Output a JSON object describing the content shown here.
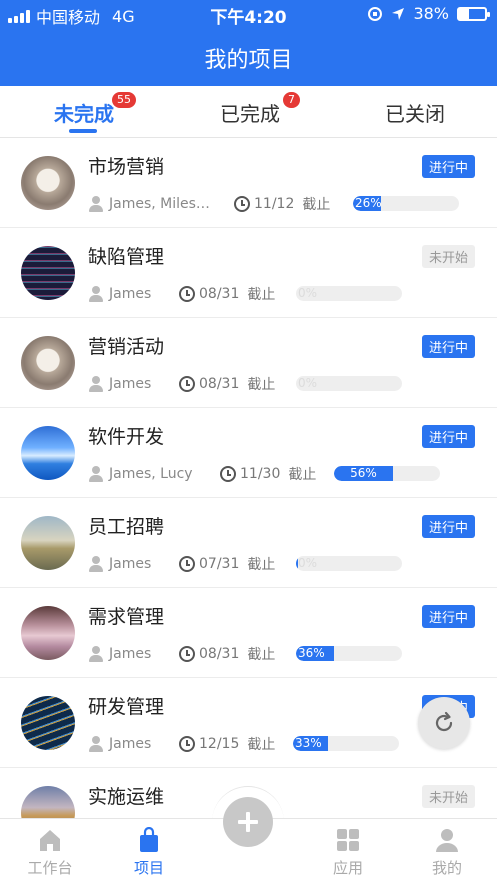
{
  "status_bar": {
    "carrier": "中国移动",
    "network": "4G",
    "time": "下午4:20",
    "battery": "38%",
    "battery_level": 0.38
  },
  "header": {
    "title": "我的项目"
  },
  "tabs": [
    {
      "label": "未完成",
      "badge": "55",
      "active": true
    },
    {
      "label": "已完成",
      "badge": "7",
      "active": false
    },
    {
      "label": "已关闭",
      "badge": "",
      "active": false
    }
  ],
  "projects": [
    {
      "name": "市场营销",
      "status": "进行中",
      "members": "James, Miles…",
      "date": "11/12",
      "deadline_label": "截止",
      "progress": 26,
      "progress_text": "26%"
    },
    {
      "name": "缺陷管理",
      "status": "未开始",
      "members": "James",
      "date": "08/31",
      "deadline_label": "截止",
      "progress": 0,
      "progress_text": "0%"
    },
    {
      "name": "营销活动",
      "status": "进行中",
      "members": "James",
      "date": "08/31",
      "deadline_label": "截止",
      "progress": 0,
      "progress_text": "0%"
    },
    {
      "name": "软件开发",
      "status": "进行中",
      "members": "James, Lucy",
      "date": "11/30",
      "deadline_label": "截止",
      "progress": 56,
      "progress_text": "56%"
    },
    {
      "name": "员工招聘",
      "status": "进行中",
      "members": "James",
      "date": "07/31",
      "deadline_label": "截止",
      "progress": 2,
      "progress_text": "0%"
    },
    {
      "name": "需求管理",
      "status": "进行中",
      "members": "James",
      "date": "08/31",
      "deadline_label": "截止",
      "progress": 36,
      "progress_text": "36%"
    },
    {
      "name": "研发管理",
      "status": "进行中",
      "members": "James",
      "date": "12/15",
      "deadline_label": "截止",
      "progress": 33,
      "progress_text": "33%"
    },
    {
      "name": "实施运维",
      "status": "未开始",
      "members": "",
      "date": "",
      "deadline_label": "",
      "progress": 0,
      "progress_text": ""
    }
  ],
  "tabbar": {
    "items": [
      {
        "label": "工作台",
        "icon": "home-icon",
        "active": false
      },
      {
        "label": "项目",
        "icon": "bag-icon",
        "active": true
      },
      {
        "label": "应用",
        "icon": "grid-icon",
        "active": false
      },
      {
        "label": "我的",
        "icon": "user-icon",
        "active": false
      }
    ]
  },
  "colors": {
    "primary": "#2a74f0",
    "badge": "#e53935",
    "idle": "#eeeeee"
  },
  "icons": {
    "refresh": "refresh-icon",
    "add": "plus-icon"
  }
}
